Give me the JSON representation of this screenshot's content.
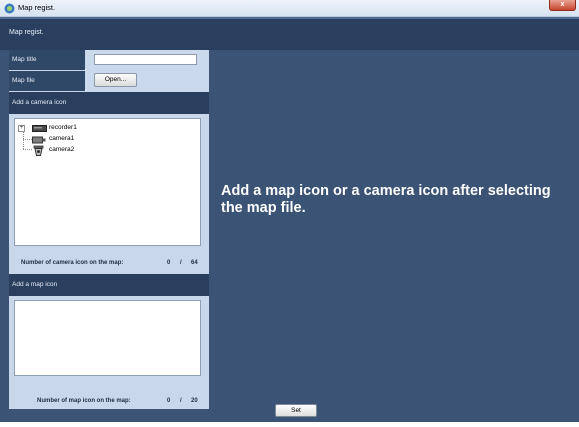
{
  "window": {
    "title": "Map regist.",
    "close_label": "x"
  },
  "header": {
    "title": "Map regist."
  },
  "form": {
    "map_title_label": "Map title",
    "map_title_value": "",
    "map_file_label": "Map file",
    "open_button_label": "Open..."
  },
  "camera_section": {
    "title": "Add a camera icon",
    "tree": [
      {
        "label": "recorder1",
        "icon": "recorder-icon"
      },
      {
        "label": "camera1",
        "icon": "box-camera-icon"
      },
      {
        "label": "camera2",
        "icon": "dome-camera-icon"
      }
    ],
    "count_label": "Number of camera icon on the map:",
    "count_current": "0",
    "count_separator": "/",
    "count_max": "64"
  },
  "map_icon_section": {
    "title": "Add a map icon",
    "count_label": "Number of map icon on the map:",
    "count_current": "0",
    "count_separator": "/",
    "count_max": "20"
  },
  "message": "Add a map icon or a camera icon after selecting the map file.",
  "footer": {
    "set_button_label": "Set"
  },
  "colors": {
    "background": "#3b5374",
    "header": "#2a3f5e",
    "panel": "#c9d7ea"
  }
}
